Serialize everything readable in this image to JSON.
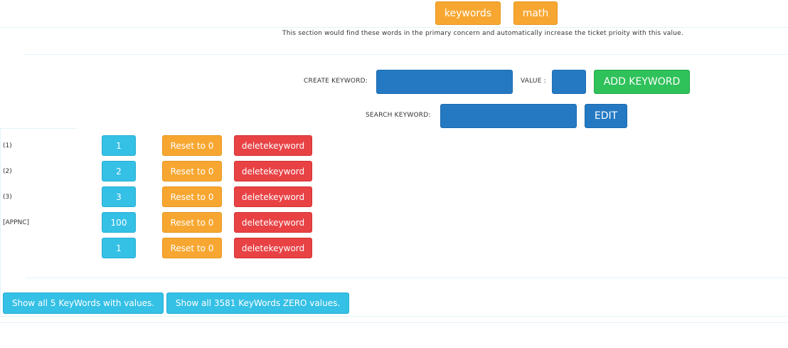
{
  "tabs": [
    {
      "label": "keywords"
    },
    {
      "label": "math"
    }
  ],
  "description": "This section would find these words in the primary concern and automatically increase the ticket prioity with this value.",
  "create": {
    "label": "CREATE KEYWORD:",
    "keyword_value": "",
    "value_label": "VALUE :",
    "value_value": "",
    "add_button": "ADD KEYWORD"
  },
  "search": {
    "label": "SEARCH KEYWORD:",
    "value": "",
    "edit_button": "EDIT"
  },
  "rows": [
    {
      "keyword": "(1)",
      "value": "1",
      "reset": "Reset to 0",
      "delete": "deletekeyword"
    },
    {
      "keyword": "(2)",
      "value": "2",
      "reset": "Reset to 0",
      "delete": "deletekeyword"
    },
    {
      "keyword": "(3)",
      "value": "3",
      "reset": "Reset to 0",
      "delete": "deletekeyword"
    },
    {
      "keyword": "[APPNC]",
      "value": "100",
      "reset": "Reset to 0",
      "delete": "deletekeyword"
    },
    {
      "keyword": "",
      "value": "1",
      "reset": "Reset to 0",
      "delete": "deletekeyword"
    }
  ],
  "footer": {
    "show_values_button": "Show all 5 KeyWords with values.",
    "show_zero_button": "Show all 3581 KeyWords ZERO values."
  },
  "colors": {
    "orange": "#f7a731",
    "cyan": "#35c0e6",
    "red": "#e84245",
    "green": "#2fc15a",
    "blue": "#2479c2"
  }
}
